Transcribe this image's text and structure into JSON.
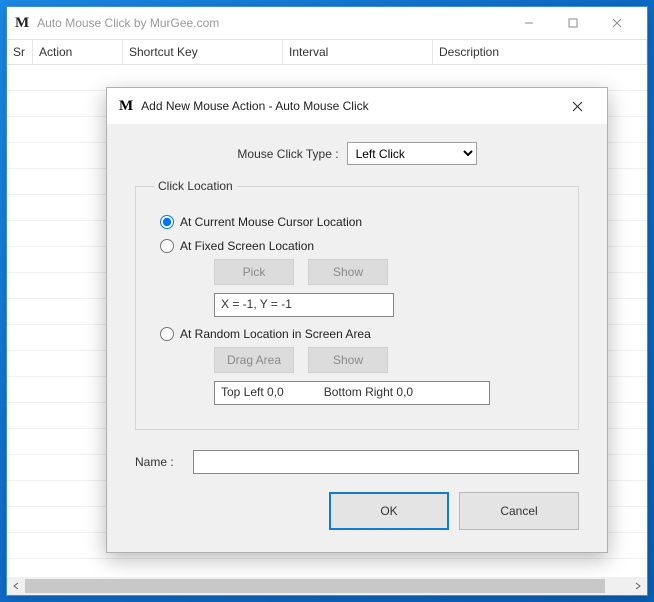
{
  "main": {
    "title": "Auto Mouse Click by MurGee.com",
    "columns": {
      "sr": "Sr",
      "action": "Action",
      "shortcut": "Shortcut Key",
      "interval": "Interval",
      "description": "Description"
    }
  },
  "dialog": {
    "title": "Add New Mouse Action - Auto Mouse Click",
    "type_label": "Mouse Click Type :",
    "type_value": "Left Click",
    "group": {
      "legend": "Click Location",
      "opt_current": "At Current Mouse Cursor Location",
      "opt_fixed": "At Fixed Screen Location",
      "opt_random": "At Random Location in Screen Area",
      "pick_btn": "Pick",
      "show_btn": "Show",
      "dragarea_btn": "Drag Area",
      "xy_text": "X = -1, Y = -1",
      "topleft_text": "Top Left 0,0",
      "bottomright_text": "Bottom Right 0,0"
    },
    "name_label": "Name :",
    "name_value": "",
    "ok": "OK",
    "cancel": "Cancel"
  }
}
